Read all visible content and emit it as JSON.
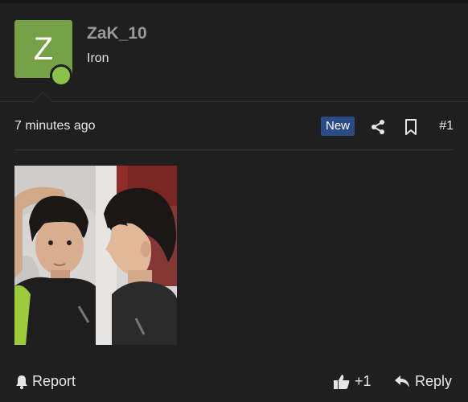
{
  "user": {
    "avatar_letter": "Z",
    "username": "ZaK_10",
    "rank": "Iron",
    "avatar_color": "#77a147",
    "online_color": "#8bc34a"
  },
  "post": {
    "time": "7 minutes ago",
    "badge": "New",
    "post_number": "#1",
    "badge_color": "#2b4b86"
  },
  "actions": {
    "share_icon": "share-icon",
    "bookmark_icon": "bookmark-icon"
  },
  "footer": {
    "report_label": "Report",
    "like_count": "+1",
    "reply_label": "Reply"
  }
}
